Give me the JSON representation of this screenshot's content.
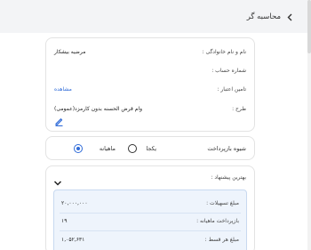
{
  "header": {
    "title": "محاسبه گر",
    "back_icon": "chevron-left-icon"
  },
  "info": {
    "name_label": "نام و نام خانوادگی :",
    "name_value": "مرضیه بیشکار",
    "account_label": "شماره حساب :",
    "account_value": "",
    "credit_label": "تامین اعتبار :",
    "credit_value": "مشاهده",
    "plan_label": "طرح :",
    "plan_value": "وام قرض الحسنه بدون کارمزد(عمومی)"
  },
  "payment": {
    "label": "شیوه بازپرداخت",
    "options": [
      {
        "label": "یکجا",
        "selected": false
      },
      {
        "label": "ماهیانه",
        "selected": true
      }
    ]
  },
  "offer": {
    "title": "بهترین پیشنهاد :",
    "rows": [
      {
        "label": "مبلغ تسهیلات :",
        "value": "۲۰,۰۰۰,۰۰۰"
      },
      {
        "label": "بازپرداخت ماهیانه :",
        "value": "۱۹"
      },
      {
        "label": "مبلغ هر قسط :",
        "value": "۱,۰۵۲,۶۳۱"
      }
    ]
  },
  "colors": {
    "accent": "#2f6bd8",
    "header_bg": "#f3f4f6",
    "offer_bg": "#eef4fc"
  }
}
